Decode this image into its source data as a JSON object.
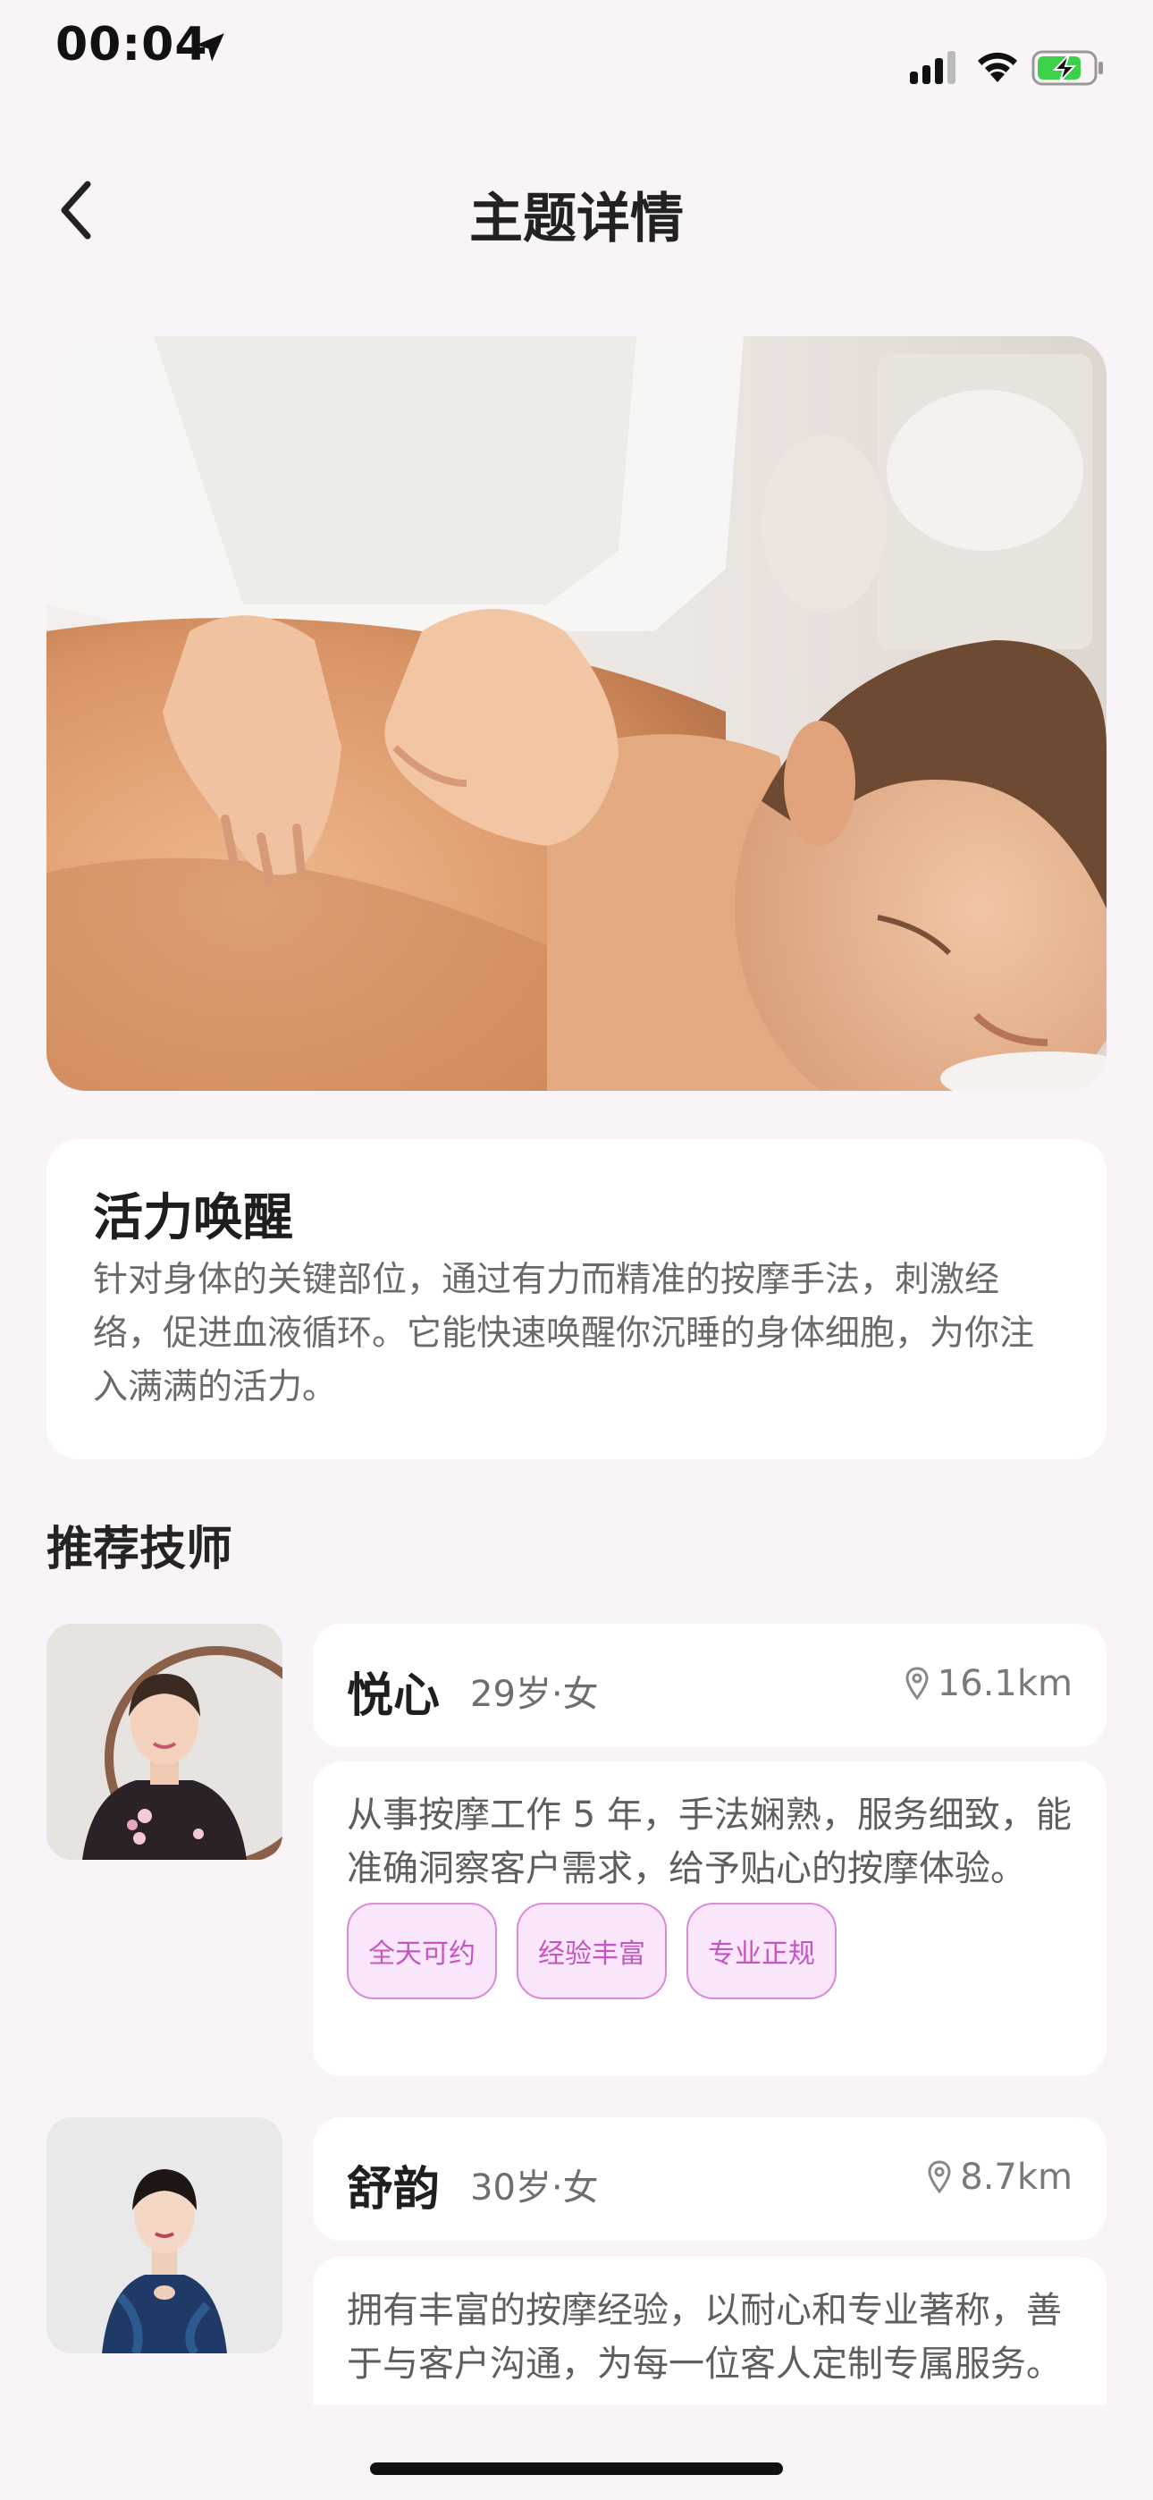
{
  "status_bar": {
    "time": "00:04"
  },
  "nav": {
    "title": "主题详情"
  },
  "theme": {
    "title": "活力唤醒",
    "description": "针对身体的关键部位，通过有力而精准的按摩手法，刺激经络，促进血液循环。它能快速唤醒你沉睡的身体细胞，为你注入满满的活力。"
  },
  "recommend": {
    "section_title": "推荐技师",
    "therapists": [
      {
        "name": "悦心",
        "meta": "29岁·女",
        "distance": "16.1km",
        "bio": "从事按摩工作 5 年，手法娴熟，服务细致，能准确洞察客户需求，给予贴心的按摩体验。",
        "tags": [
          "全天可约",
          "经验丰富",
          "专业正规"
        ]
      },
      {
        "name": "舒韵",
        "meta": "30岁·女",
        "distance": "8.7km",
        "bio": "拥有丰富的按摩经验，以耐心和专业著称，善于与客户沟通，为每一位客人定制专属服务。"
      }
    ]
  },
  "colors": {
    "background": "#f8f4f8",
    "tag_border": "#d98ad8",
    "tag_fill": "#fae6fb",
    "tag_text": "#c655c2",
    "battery_green": "#3dd14a"
  },
  "icons": {
    "location": "location-arrow-icon",
    "signal": "cellular-signal-icon",
    "wifi": "wifi-icon",
    "battery": "battery-charging-icon",
    "back": "chevron-left-icon",
    "pin": "map-pin-icon"
  }
}
